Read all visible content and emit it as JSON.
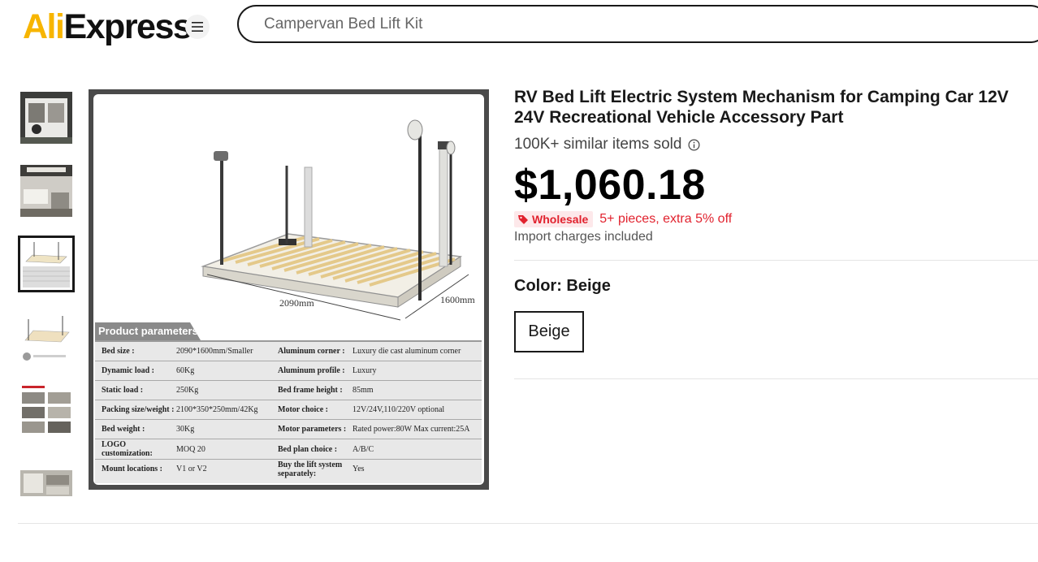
{
  "header": {
    "logo_prefix": "Ali",
    "logo_suffix": "Express",
    "search_value": "",
    "search_placeholder": "Campervan Bed Lift Kit"
  },
  "gallery": {
    "thumbnails": [
      {
        "name": "van-rear-view"
      },
      {
        "name": "van-interior"
      },
      {
        "name": "bed-frame-params",
        "selected": true
      },
      {
        "name": "bed-lift-stable"
      },
      {
        "name": "product-features"
      },
      {
        "name": "van-bed-install"
      }
    ],
    "main_image": {
      "dim_length": "2090mm",
      "dim_width": "1600mm",
      "params_title": "Product parameters",
      "params": [
        {
          "k1": "Bed size :",
          "v1": "2090*1600mm/Smaller",
          "k2": "Aluminum corner :",
          "v2": "Luxury die cast aluminum corner"
        },
        {
          "k1": "Dynamic load :",
          "v1": "60Kg",
          "k2": "Aluminum profile :",
          "v2": "Luxury"
        },
        {
          "k1": "Static load :",
          "v1": "250Kg",
          "k2": "Bed frame height :",
          "v2": "85mm"
        },
        {
          "k1": "Packing size/weight :",
          "v1": "2100*350*250mm/42Kg",
          "k2": "Motor choice :",
          "v2": "12V/24V,110/220V optional"
        },
        {
          "k1": "Bed weight :",
          "v1": "30Kg",
          "k2": "Motor parameters :",
          "v2": "Rated power:80W Max current:25A"
        },
        {
          "k1": "LOGO customization:",
          "v1": "MOQ 20",
          "k2": "Bed plan choice :",
          "v2": "A/B/C"
        },
        {
          "k1": "Mount locations :",
          "v1": "V1 or V2",
          "k2": "Buy the lift system separately:",
          "v2": "Yes"
        }
      ]
    }
  },
  "product": {
    "title": "RV Bed Lift Electric System Mechanism for Camping Car 12V 24V Recreational Vehicle Accessory Part",
    "sold": "100K+ similar items sold",
    "price": "$1,060.18",
    "wholesale_label": "Wholesale",
    "promo": "5+ pieces, extra 5% off",
    "import_note": "Import charges included",
    "color_label": "Color: Beige",
    "color_options": [
      "Beige"
    ]
  },
  "colors": {
    "accent_red": "#e1222e",
    "logo_yellow": "#f7b500",
    "text": "#191919"
  }
}
